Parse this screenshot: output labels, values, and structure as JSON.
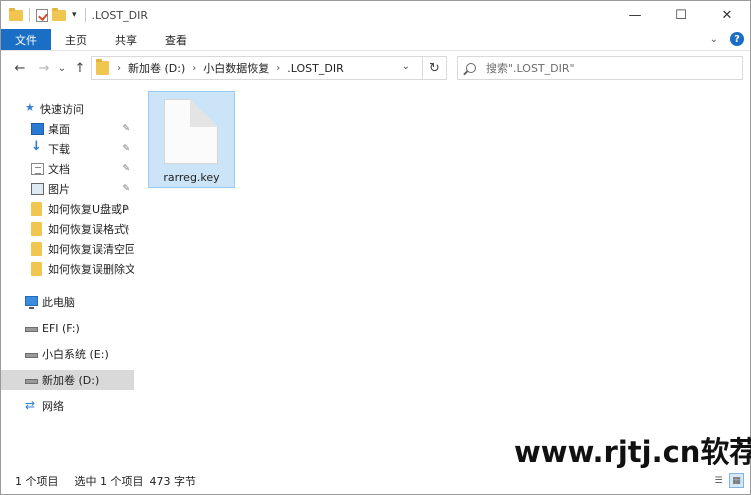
{
  "window": {
    "title": ".LOST_DIR",
    "controls": {
      "minimize": "—",
      "maximize": "☐",
      "close": "✕"
    }
  },
  "ribbon": {
    "tabs": [
      "文件",
      "主页",
      "共享",
      "查看"
    ],
    "expand_icon": "chevron-down-icon",
    "help_label": "?"
  },
  "nav": {
    "back": "←",
    "forward": "→",
    "recent": "⌄",
    "up": "↑",
    "breadcrumbs": [
      "新加卷 (D:)",
      "小白数据恢复",
      ".LOST_DIR"
    ],
    "refresh": "↻",
    "search_placeholder": "搜索\".LOST_DIR\""
  },
  "sidebar": {
    "quick_access": "快速访问",
    "pinned": [
      {
        "label": "桌面",
        "icon": "desktop-icon"
      },
      {
        "label": "下载",
        "icon": "download-icon"
      },
      {
        "label": "文档",
        "icon": "document-icon"
      },
      {
        "label": "图片",
        "icon": "pictures-icon"
      },
      {
        "label": "如何恢复U盘或P",
        "icon": "folder-icon"
      },
      {
        "label": "如何恢复误格式(",
        "icon": "folder-icon"
      }
    ],
    "recent": [
      {
        "label": "如何恢复误清空回收",
        "icon": "folder-icon"
      },
      {
        "label": "如何恢复误删除文件",
        "icon": "folder-icon"
      }
    ],
    "this_pc": "此电脑",
    "drives": [
      {
        "label": "EFI (F:)",
        "selected": false
      },
      {
        "label": "小白系统 (E:)",
        "selected": false
      },
      {
        "label": "新加卷 (D:)",
        "selected": true
      }
    ],
    "network": "网络"
  },
  "content": {
    "files": [
      {
        "name": "rarreg.key",
        "selected": true
      }
    ]
  },
  "watermark": "www.rjtj.cn软荐网",
  "status": {
    "count": "1 个项目",
    "selected": "选中 1 个项目",
    "size": "473 字节"
  },
  "colors": {
    "accent": "#1a6fc4",
    "selection": "#cce4f7"
  }
}
